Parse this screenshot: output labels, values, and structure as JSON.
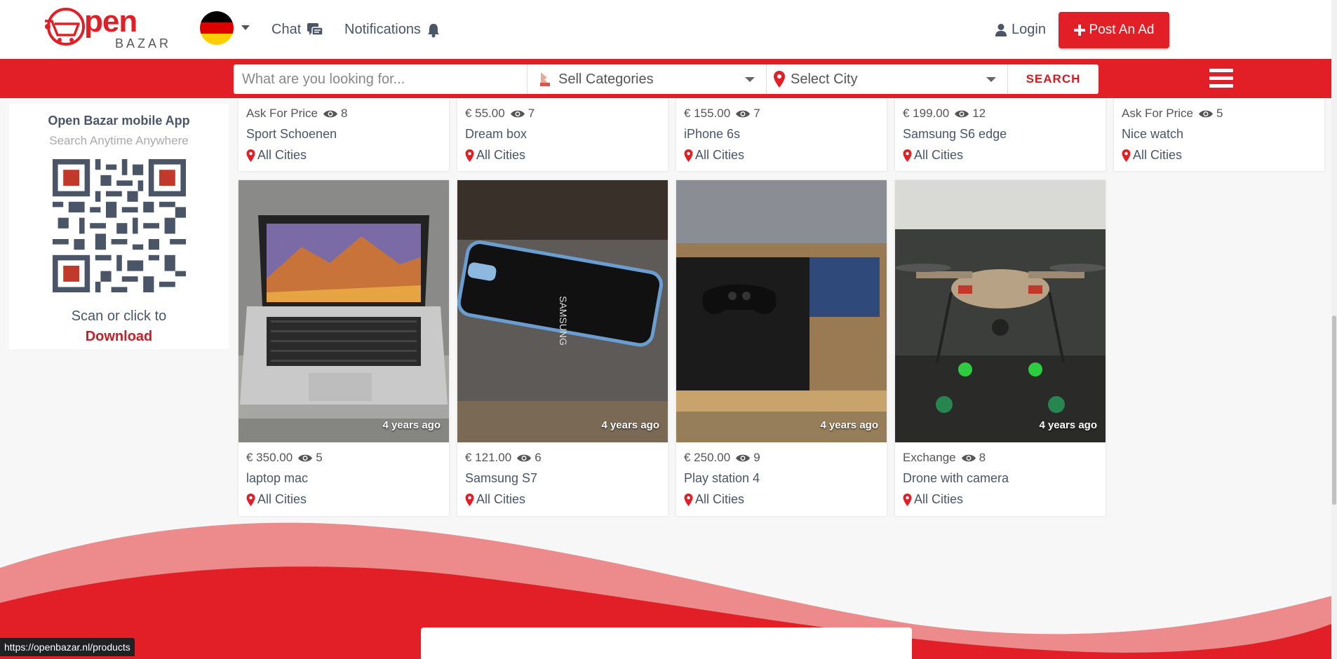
{
  "header": {
    "logo_word": "pen",
    "logo_sub": "BAZAR",
    "chat_label": "Chat",
    "notifications_label": "Notifications",
    "login_label": "Login",
    "post_ad_label": "Post An Ad"
  },
  "search": {
    "placeholder": "What are you looking for...",
    "category_value": "Sell Categories",
    "city_value": "Select City",
    "search_button": "SEARCH"
  },
  "sidebar": {
    "app_title": "Open Bazar mobile App",
    "app_subtitle": "Search Anytime Anywhere",
    "scan_text": "Scan or click to",
    "download_label": "Download"
  },
  "products_top": [
    {
      "price": "Ask For Price",
      "views": "8",
      "title": "Sport Schoenen",
      "location": "All Cities"
    },
    {
      "price": "€ 55.00",
      "views": "7",
      "title": "Dream box",
      "location": "All Cities"
    },
    {
      "price": "€ 155.00",
      "views": "7",
      "title": "iPhone 6s",
      "location": "All Cities"
    },
    {
      "price": "€ 199.00",
      "views": "12",
      "title": "Samsung S6 edge",
      "location": "All Cities"
    },
    {
      "price": "Ask For Price",
      "views": "5",
      "title": "Nice watch",
      "location": "All Cities"
    }
  ],
  "products_bottom": [
    {
      "price": "€ 350.00",
      "views": "5",
      "title": "laptop mac",
      "location": "All Cities",
      "age": "4 years ago"
    },
    {
      "price": "€ 121.00",
      "views": "6",
      "title": "Samsung S7",
      "location": "All Cities",
      "age": "4 years ago"
    },
    {
      "price": "€ 250.00",
      "views": "9",
      "title": "Play station 4",
      "location": "All Cities",
      "age": "4 years ago"
    },
    {
      "price": "Exchange",
      "views": "8",
      "title": "Drone with camera",
      "location": "All Cities",
      "age": "4 years ago"
    }
  ],
  "status_bar": {
    "url": "https://openbazar.nl/products"
  },
  "colors": {
    "brand_red": "#e21f26",
    "text_slate": "#4a5568"
  }
}
